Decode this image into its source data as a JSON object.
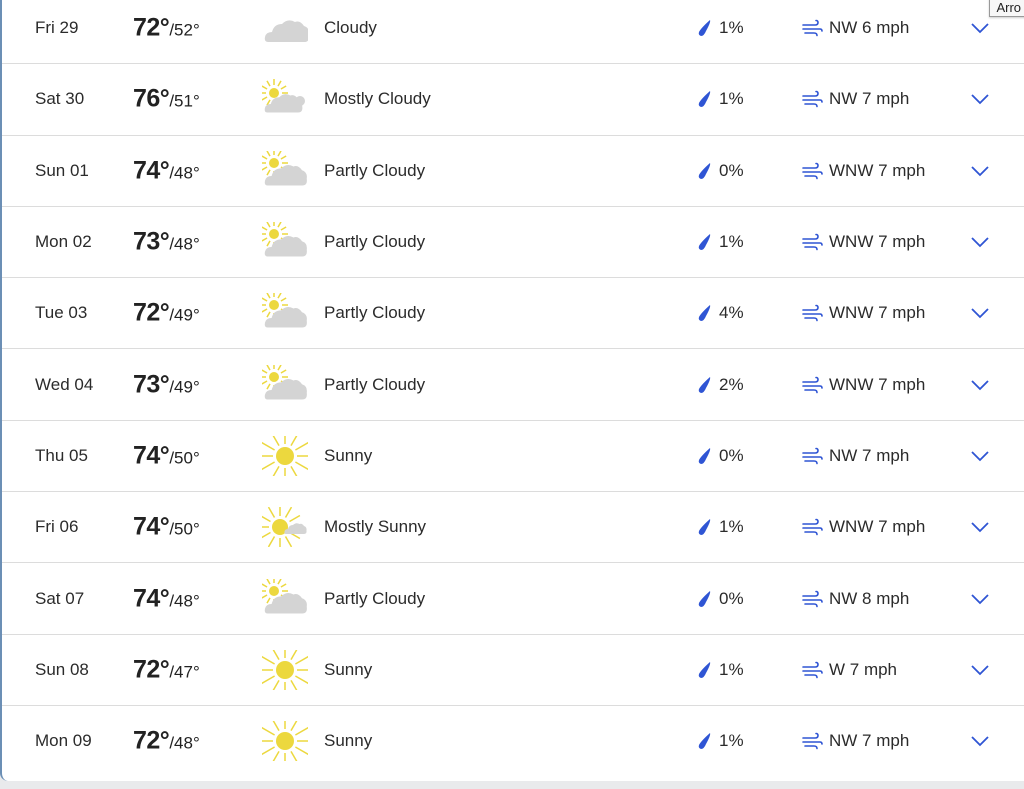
{
  "tooltip": "Arro",
  "colors": {
    "accent": "#2f55d4",
    "cloud": "#d4d4d4",
    "sun": "#ecd83e"
  },
  "days": [
    {
      "day": "Fri 29",
      "high": "72°",
      "low": "/52°",
      "icon": "cloudy",
      "condition": "Cloudy",
      "precip": "1%",
      "wind": "NW 6 mph"
    },
    {
      "day": "Sat 30",
      "high": "76°",
      "low": "/51°",
      "icon": "mostly-cloudy",
      "condition": "Mostly Cloudy",
      "precip": "1%",
      "wind": "NW 7 mph"
    },
    {
      "day": "Sun 01",
      "high": "74°",
      "low": "/48°",
      "icon": "partly-cloudy",
      "condition": "Partly Cloudy",
      "precip": "0%",
      "wind": "WNW 7 mph"
    },
    {
      "day": "Mon 02",
      "high": "73°",
      "low": "/48°",
      "icon": "partly-cloudy",
      "condition": "Partly Cloudy",
      "precip": "1%",
      "wind": "WNW 7 mph"
    },
    {
      "day": "Tue 03",
      "high": "72°",
      "low": "/49°",
      "icon": "partly-cloudy",
      "condition": "Partly Cloudy",
      "precip": "4%",
      "wind": "WNW 7 mph"
    },
    {
      "day": "Wed 04",
      "high": "73°",
      "low": "/49°",
      "icon": "partly-cloudy",
      "condition": "Partly Cloudy",
      "precip": "2%",
      "wind": "WNW 7 mph"
    },
    {
      "day": "Thu 05",
      "high": "74°",
      "low": "/50°",
      "icon": "sunny",
      "condition": "Sunny",
      "precip": "0%",
      "wind": "NW 7 mph"
    },
    {
      "day": "Fri 06",
      "high": "74°",
      "low": "/50°",
      "icon": "mostly-sunny",
      "condition": "Mostly Sunny",
      "precip": "1%",
      "wind": "WNW 7 mph"
    },
    {
      "day": "Sat 07",
      "high": "74°",
      "low": "/48°",
      "icon": "partly-cloudy",
      "condition": "Partly Cloudy",
      "precip": "0%",
      "wind": "NW 8 mph"
    },
    {
      "day": "Sun 08",
      "high": "72°",
      "low": "/47°",
      "icon": "sunny",
      "condition": "Sunny",
      "precip": "1%",
      "wind": "W 7 mph"
    },
    {
      "day": "Mon 09",
      "high": "72°",
      "low": "/48°",
      "icon": "sunny",
      "condition": "Sunny",
      "precip": "1%",
      "wind": "NW 7 mph"
    }
  ]
}
